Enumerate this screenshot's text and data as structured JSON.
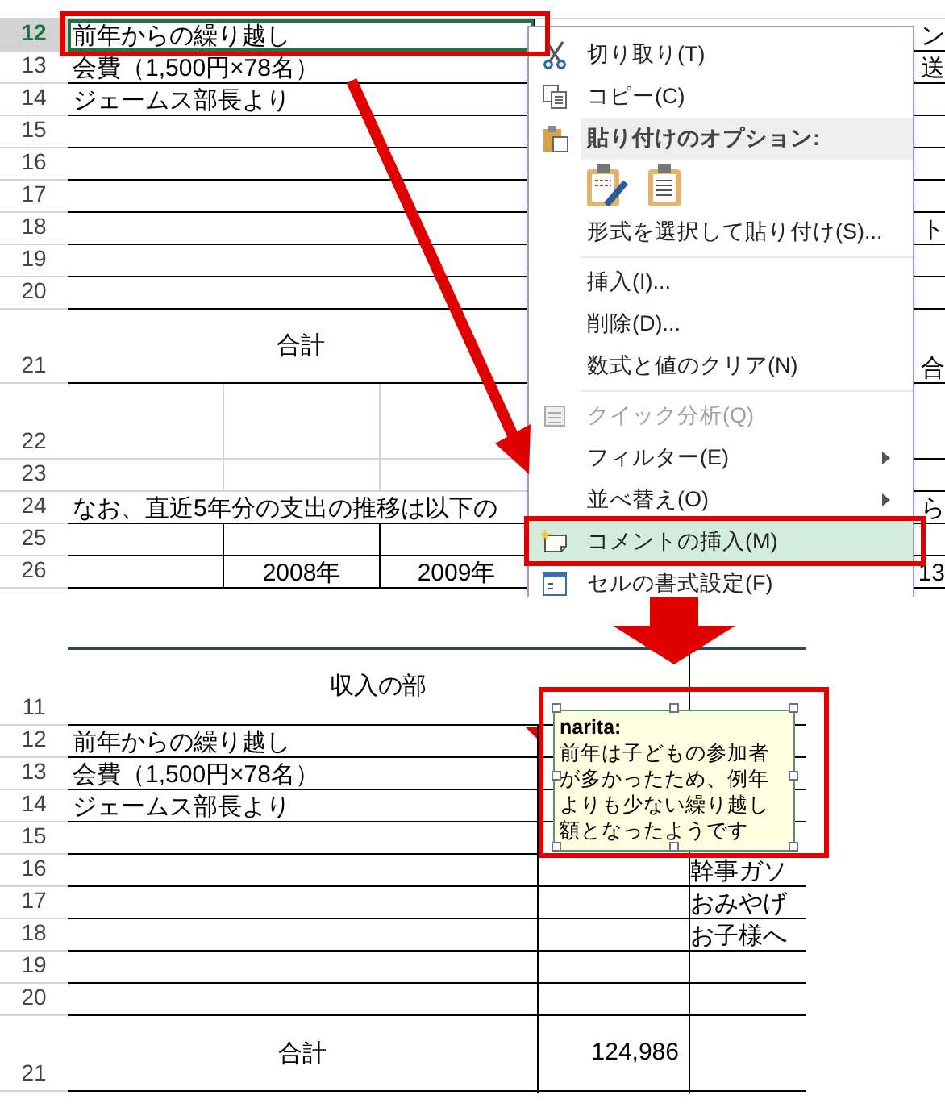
{
  "top_sheet": {
    "rows": [
      {
        "number": "12",
        "kind": "merged",
        "selected": true,
        "text": "前年からの繰り越し",
        "column_4": "ン"
      },
      {
        "number": "13",
        "kind": "merged",
        "selected": false,
        "text": "会費（1,500円×78名）",
        "column_4": "送"
      },
      {
        "number": "14",
        "kind": "merged",
        "selected": false,
        "text": "ジェームス部長より"
      },
      {
        "number": "15",
        "kind": "merged",
        "selected": false
      },
      {
        "number": "16",
        "kind": "merged",
        "selected": false
      },
      {
        "number": "17",
        "kind": "merged",
        "selected": false
      },
      {
        "number": "18",
        "kind": "merged",
        "selected": false,
        "column_4": "ト"
      },
      {
        "number": "19",
        "kind": "merged",
        "selected": false
      },
      {
        "number": "20",
        "kind": "merged",
        "selected": false
      },
      {
        "number": "21",
        "kind": "total",
        "selected": false,
        "text": "合計",
        "column_4": "合"
      },
      {
        "number": "22",
        "kind": "tall",
        "selected": false
      },
      {
        "number": "23",
        "kind": "split",
        "selected": false
      },
      {
        "number": "24",
        "kind": "merged",
        "selected": false,
        "text": "なお、直近5年分の支出の推移は以下の",
        "column_4": "ら"
      },
      {
        "number": "25",
        "kind": "split",
        "selected": false
      },
      {
        "number": "26",
        "kind": "split",
        "selected": false,
        "column_2": "2008年",
        "column_3": "2009年",
        "column_4": "13"
      }
    ]
  },
  "context_menu": {
    "items": [
      {
        "kind": "cut",
        "label": "切り取り(T)",
        "selected": false,
        "disabled": false
      },
      {
        "kind": "copy",
        "label": "コピー(C)",
        "selected": false,
        "disabled": false
      },
      {
        "kind": "header",
        "label": "貼り付けのオプション:"
      },
      {
        "kind": "paste_icons"
      },
      {
        "kind": "plain",
        "label": "形式を選択して貼り付け(S)...",
        "selected": false,
        "disabled": false
      },
      {
        "kind": "separator"
      },
      {
        "kind": "plain",
        "label": "挿入(I)...",
        "selected": false,
        "disabled": false
      },
      {
        "kind": "plain",
        "label": "削除(D)...",
        "selected": false,
        "disabled": false
      },
      {
        "kind": "plain",
        "label": "数式と値のクリア(N)",
        "selected": false,
        "disabled": false
      },
      {
        "kind": "separator"
      },
      {
        "kind": "quick",
        "label": "クイック分析(Q)",
        "selected": false,
        "disabled": true
      },
      {
        "kind": "submenu",
        "label": "フィルター(E)",
        "selected": false,
        "disabled": false
      },
      {
        "kind": "submenu",
        "label": "並べ替え(O)",
        "selected": false,
        "disabled": false
      },
      {
        "kind": "comment",
        "label": "コメントの挿入(M)",
        "selected": true,
        "disabled": false
      },
      {
        "kind": "format",
        "label": "セルの書式設定(F)",
        "selected": false,
        "disabled": false
      }
    ]
  },
  "bottom_sheet": {
    "rows": [
      {
        "number": "11",
        "kind": "header",
        "text": "収入の部"
      },
      {
        "number": "12",
        "kind": "merged",
        "text": "前年からの繰り越し"
      },
      {
        "number": "13",
        "kind": "merged",
        "text": "会費（1,500円×78名）"
      },
      {
        "number": "14",
        "kind": "merged",
        "text": "ジェームス部長より"
      },
      {
        "number": "15",
        "kind": "merged"
      },
      {
        "number": "16",
        "kind": "merged",
        "column_3": "幹事ガソ"
      },
      {
        "number": "17",
        "kind": "merged",
        "column_3": "おみやげ"
      },
      {
        "number": "18",
        "kind": "merged",
        "column_3": "お子様へ"
      },
      {
        "number": "19",
        "kind": "merged"
      },
      {
        "number": "20",
        "kind": "merged"
      },
      {
        "number": "21",
        "kind": "total",
        "text": "合計",
        "column_2": "124,986"
      }
    ]
  },
  "comment": {
    "author": "narita:",
    "text": "前年は子どもの参加者が多かったため、例年よりも少ない繰り越し額となったようです"
  }
}
